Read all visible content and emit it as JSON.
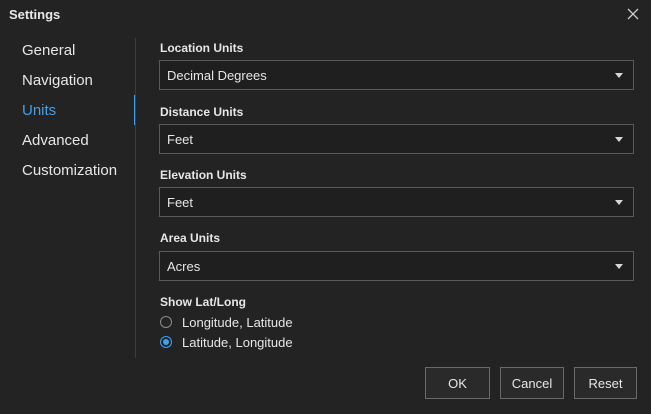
{
  "window": {
    "title": "Settings",
    "close_icon": "close-icon"
  },
  "nav": {
    "items": [
      {
        "label": "General"
      },
      {
        "label": "Navigation"
      },
      {
        "label": "Units"
      },
      {
        "label": "Advanced"
      },
      {
        "label": "Customization"
      }
    ],
    "active": "Units"
  },
  "fields": {
    "location_units": {
      "label": "Location Units",
      "value": "Decimal Degrees"
    },
    "distance_units": {
      "label": "Distance Units",
      "value": "Feet"
    },
    "elevation_units": {
      "label": "Elevation Units",
      "value": "Feet"
    },
    "area_units": {
      "label": "Area Units",
      "value": "Acres"
    }
  },
  "show_latlong": {
    "label": "Show Lat/Long",
    "options": [
      {
        "label": "Longitude, Latitude",
        "checked": false
      },
      {
        "label": "Latitude, Longitude",
        "checked": true
      }
    ]
  },
  "buttons": {
    "ok": "OK",
    "cancel": "Cancel",
    "reset": "Reset"
  },
  "colors": {
    "accent": "#3ea0f0",
    "background": "#232323",
    "field_bg": "#1f1f1f",
    "border": "#5a5a5a"
  }
}
